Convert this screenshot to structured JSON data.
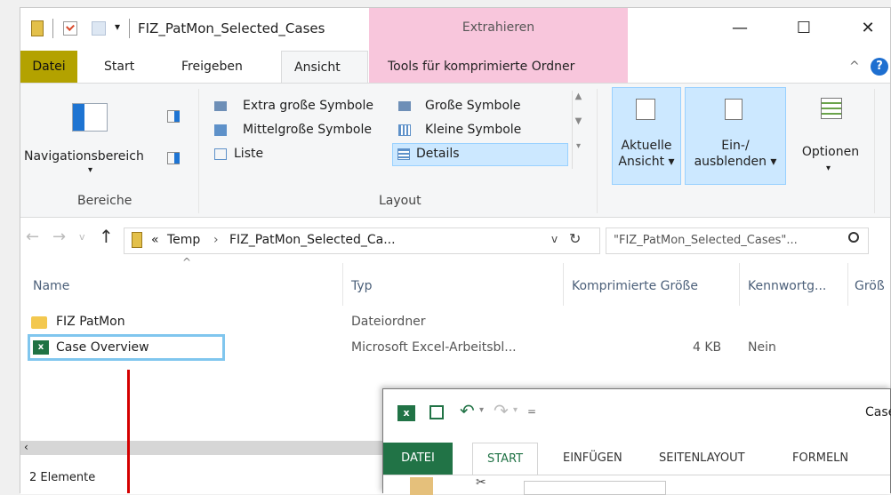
{
  "title": {
    "folder_name": "FIZ_PatMon_Selected_Cases",
    "context_tab": "Extrahieren",
    "minimize": "—",
    "maximize": "☐",
    "close": "✕"
  },
  "tabs": {
    "datei": "Datei",
    "start": "Start",
    "freigeben": "Freigeben",
    "ansicht": "Ansicht",
    "tools": "Tools für komprimierte Ordner",
    "help": "?"
  },
  "ribbon": {
    "nav_pane": "Navigationsbereich",
    "group_panes": "Bereiche",
    "layout_items": [
      "Extra große Symbole",
      "Große Symbole",
      "Mittelgroße Symbole",
      "Kleine Symbole",
      "Liste",
      "Details"
    ],
    "group_layout": "Layout",
    "current_view_1": "Aktuelle",
    "current_view_2": "Ansicht ▾",
    "show_hide_1": "Ein-/",
    "show_hide_2": "ausblenden ▾",
    "options": "Optionen"
  },
  "address": {
    "prefix": "«",
    "crumb1": "Temp",
    "sep": "›",
    "crumb2": "FIZ_PatMon_Selected_Ca...",
    "search_placeholder": "\"FIZ_PatMon_Selected_Cases\"..."
  },
  "columns": {
    "name": "Name",
    "type": "Typ",
    "compressed_size": "Komprimierte Größe",
    "password": "Kennwortg...",
    "size": "Größ"
  },
  "rows": [
    {
      "name": "FIZ PatMon",
      "type": "Dateiordner",
      "size": "",
      "password": ""
    },
    {
      "name": "Case Overview",
      "type": "Microsoft Excel-Arbeitsbl...",
      "size": "4 KB",
      "password": "Nein"
    }
  ],
  "status": {
    "count": "2 Elemente"
  },
  "excel": {
    "title_partial": "Case",
    "file_tab": "DATEI",
    "tabs": [
      "START",
      "EINFÜGEN",
      "SEITENLAYOUT",
      "FORMELN"
    ]
  },
  "colors": {
    "datei_tab": "#b3a200",
    "context_tab": "#f8c6dc",
    "selection": "#cce8ff",
    "excel_green": "#217346",
    "annotation_line": "#d40000"
  }
}
